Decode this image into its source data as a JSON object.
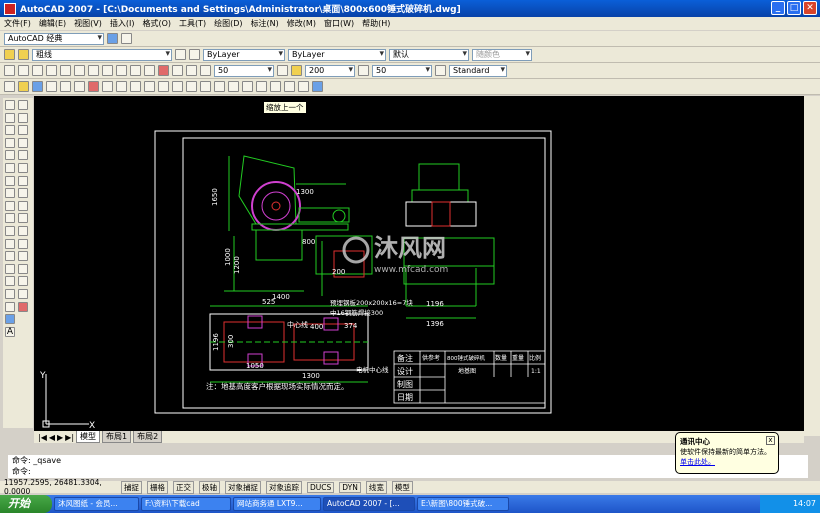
{
  "title_bar": {
    "title": "AutoCAD 2007 - [C:\\Documents and Settings\\Administrator\\桌面\\800x600锤式破碎机.dwg]"
  },
  "menu": {
    "items": [
      "文件(F)",
      "编辑(E)",
      "视图(V)",
      "插入(I)",
      "格式(O)",
      "工具(T)",
      "绘图(D)",
      "标注(N)",
      "修改(M)",
      "窗口(W)",
      "帮助(H)"
    ]
  },
  "toolbars": {
    "workspace": "AutoCAD 经典",
    "layer": "粗线",
    "color": "ByLayer",
    "linetype": "ByLayer",
    "lineweight": "默认",
    "plotstyle": "随颜色",
    "dimstyle": "50",
    "textheight": "200",
    "textstyle_size": "50",
    "textstyle": "Standard"
  },
  "tooltip": "缩放上一个",
  "drawing": {
    "dims": [
      "1300",
      "1650",
      "1000",
      "1200",
      "1400",
      "1196",
      "1396",
      "800",
      "200",
      "525",
      "300",
      "400",
      "374",
      "1196",
      "1050",
      "1300"
    ],
    "note_bolt": "预埋钢板200x200x16=7块",
    "note_bolt2": "中16钢筋焊接300",
    "center_label": "中心线",
    "motor_center": "电机中心线",
    "footnote": "注：地基高度客户根据现场实际情况而定。",
    "watermark": "沐风网",
    "watermark_url": "www.mfcad.com",
    "table": {
      "r1": [
        "备注",
        "供参考",
        "800锤式破碎机",
        "数量",
        "重量",
        "比例"
      ],
      "r2": [
        "设计",
        "地基图",
        "",
        "1:1"
      ],
      "r3": [
        "制图"
      ],
      "r4": [
        "日期"
      ]
    },
    "ucs_x": "X",
    "ucs_y": "Y"
  },
  "layout_tabs": [
    "模型",
    "布局1",
    "布局2"
  ],
  "command": {
    "line1": "命令: _qsave",
    "line2": "命令:"
  },
  "status": {
    "coords": "11957.2595, 26481.3304, 0.0000",
    "toggles": [
      "捕捉",
      "栅格",
      "正交",
      "极轴",
      "对象捕捉",
      "对象追踪",
      "DUCS",
      "DYN",
      "线宽",
      "模型"
    ]
  },
  "balloon": {
    "title": "通讯中心",
    "body": "使软件保持最新的简单方法。",
    "link": "单击此处。"
  },
  "taskbar": {
    "start": "开始",
    "tasks": [
      "沐风图纸 - 会员...",
      "F:\\资料\\下载cad",
      "网站商务通 LXT9...",
      "AutoCAD 2007 - [...",
      "E:\\新图\\800锤式破..."
    ],
    "clock": "14:07"
  },
  "colors": {
    "canvas": "#000000",
    "drawing_green": "#22cc22",
    "drawing_red": "#e03030",
    "drawing_magenta": "#d040d0",
    "accent_blue": "#0a5fd8"
  }
}
